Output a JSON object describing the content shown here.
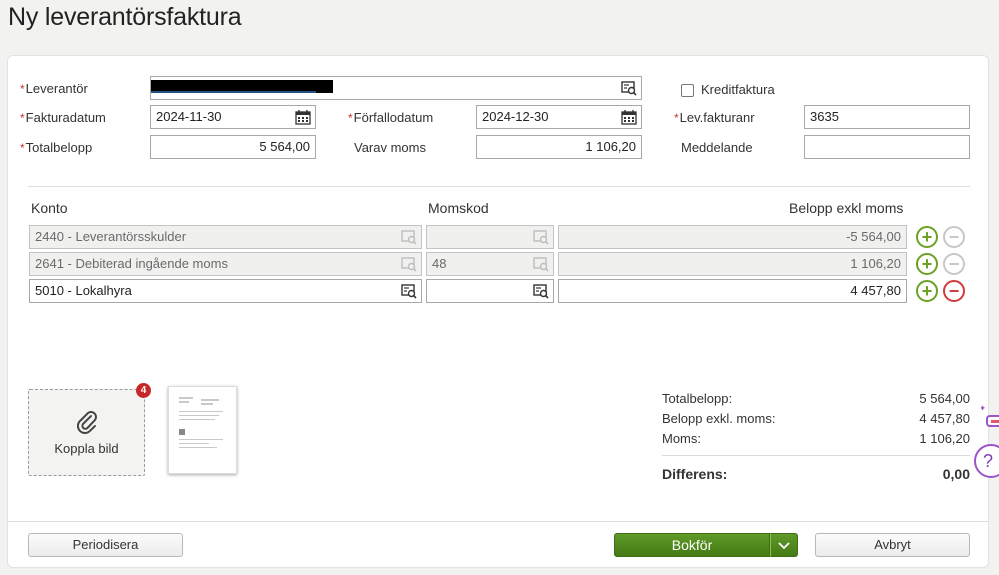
{
  "page": {
    "title": "Ny leverantörsfaktura"
  },
  "header_form": {
    "required_mark": "*",
    "leverantor_label": "Leverantör",
    "kreditfaktura_label": "Kreditfaktura",
    "fakturadatum_label": "Fakturadatum",
    "fakturadatum_value": "2024-11-30",
    "forfallodatum_label": "Förfallodatum",
    "forfallodatum_value": "2024-12-30",
    "levfakturanr_label": "Lev.fakturanr",
    "levfakturanr_value": "3635",
    "totalbelopp_label": "Totalbelopp",
    "totalbelopp_value": "5 564,00",
    "varav_moms_label": "Varav moms",
    "varav_moms_value": "1 106,20",
    "meddelande_label": "Meddelande",
    "meddelande_value": ""
  },
  "rows_table": {
    "headers": {
      "konto": "Konto",
      "momskod": "Momskod",
      "belopp": "Belopp exkl moms"
    },
    "rows": [
      {
        "konto": "2440 - Leverantörsskulder",
        "momskod": "",
        "belopp": "-5 564,00",
        "disabled": true
      },
      {
        "konto": "2641 - Debiterad ingående moms",
        "momskod": "48",
        "belopp": "1 106,20",
        "disabled": true
      },
      {
        "konto": "5010 - Lokalhyra",
        "momskod": "",
        "belopp": "4 457,80",
        "disabled": false
      }
    ],
    "add_symbol": "+",
    "remove_symbol": "−"
  },
  "attachment": {
    "label": "Koppla bild",
    "count": "4"
  },
  "summary": {
    "totalbelopp_label": "Totalbelopp:",
    "totalbelopp_value": "5 564,00",
    "exkl_label": "Belopp exkl. moms:",
    "exkl_value": "4 457,80",
    "moms_label": "Moms:",
    "moms_value": "1 106,20",
    "differens_label": "Differens:",
    "differens_value": "0,00"
  },
  "footer": {
    "periodisera_label": "Periodisera",
    "bokfor_label": "Bokför",
    "avbryt_label": "Avbryt"
  },
  "side": {
    "help_symbol": "?"
  },
  "colors": {
    "accent_green": "#5f9a28",
    "required_red": "#c0392b",
    "remove_red": "#d23a3a",
    "badge_red": "#c62828"
  },
  "icons": [
    "lookup-icon",
    "calendar-icon",
    "paperclip-icon",
    "chevron-down-icon",
    "add-row-icon",
    "remove-row-icon",
    "help-icon"
  ]
}
